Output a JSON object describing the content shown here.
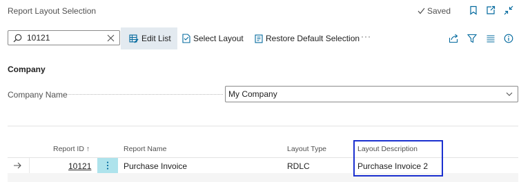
{
  "header": {
    "title": "Report Layout Selection",
    "saved_label": "Saved",
    "icons": [
      "bookmark-icon",
      "open-new-window-icon",
      "collapse-icon"
    ]
  },
  "toolbar": {
    "search_value": "10121",
    "edit_list_label": "Edit List",
    "select_layout_label": "Select Layout",
    "restore_default_label": "Restore Default Selection",
    "more_label": "···",
    "icons": [
      "share-icon",
      "filter-icon",
      "list-view-icon",
      "info-icon"
    ]
  },
  "section": {
    "title": "Company",
    "company_name_label": "Company Name",
    "company_name_value": "My Company"
  },
  "table": {
    "columns": [
      "Report ID ↑",
      "Report Name",
      "Layout Type",
      "Layout Description"
    ],
    "rows": [
      {
        "report_id": "10121",
        "report_name": "Purchase Invoice",
        "layout_type": "RDLC",
        "layout_description": "Purchase Invoice 2"
      }
    ]
  },
  "colors": {
    "accent": "#00689d",
    "active_button_bg": "#e3eaf0",
    "row_menu_bg": "#aee3ec",
    "highlight_border": "#1a2fcf"
  }
}
